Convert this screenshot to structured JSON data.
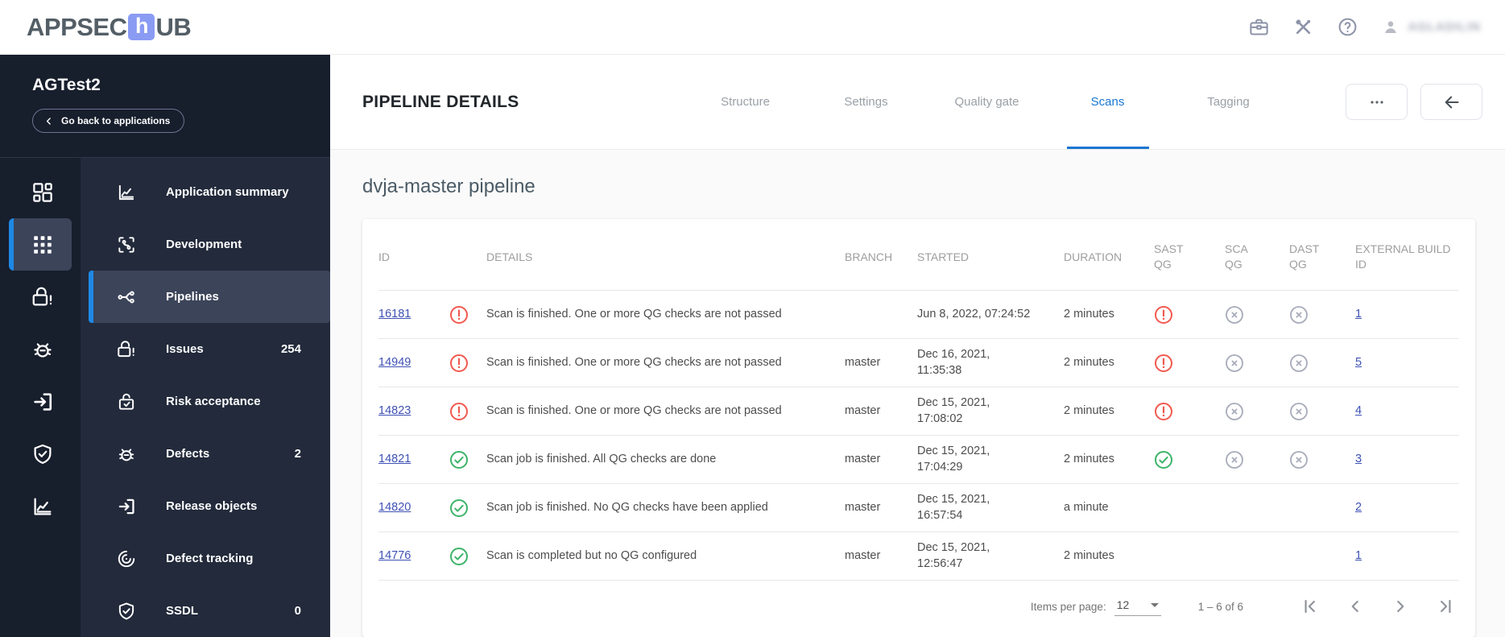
{
  "topbar": {
    "logo": {
      "prefix": "APPSEC",
      "h_letter": "h",
      "suffix": "UB"
    },
    "icons": [
      "briefcase",
      "tools",
      "help"
    ],
    "user": {
      "name": "AGLADILIN"
    }
  },
  "sidebar": {
    "project_name": "AGTest2",
    "back_button_label": "Go back to applications",
    "rail_icons": [
      {
        "icon": "dashboard",
        "active": false
      },
      {
        "icon": "apps",
        "active": true
      },
      {
        "icon": "lock-alert",
        "active": false
      },
      {
        "icon": "bug",
        "active": false
      },
      {
        "icon": "exit-to-app",
        "active": false
      },
      {
        "icon": "shield-check",
        "active": false
      },
      {
        "icon": "line-chart",
        "active": false
      }
    ],
    "items": [
      {
        "label": "Application summary",
        "icon": "line-chart",
        "count": "",
        "active": false
      },
      {
        "label": "Development",
        "icon": "development",
        "count": "",
        "active": false
      },
      {
        "label": "Pipelines",
        "icon": "pipelines",
        "count": "",
        "active": true
      },
      {
        "label": "Issues",
        "icon": "lock-alert",
        "count": "254",
        "active": false
      },
      {
        "label": "Risk acceptance",
        "icon": "lock-check",
        "count": "",
        "active": false
      },
      {
        "label": "Defects",
        "icon": "bug",
        "count": "2",
        "active": false
      },
      {
        "label": "Release objects",
        "icon": "exit-to-app",
        "count": "",
        "active": false
      },
      {
        "label": "Defect tracking",
        "icon": "track-changes",
        "count": "",
        "active": false
      },
      {
        "label": "SSDL",
        "icon": "shield-check",
        "count": "0",
        "active": false
      }
    ]
  },
  "header": {
    "title": "PIPELINE DETAILS",
    "tabs": [
      {
        "label": "Structure",
        "active": false
      },
      {
        "label": "Settings",
        "active": false
      },
      {
        "label": "Quality gate",
        "active": false
      },
      {
        "label": "Scans",
        "active": true
      },
      {
        "label": "Tagging",
        "active": false
      }
    ],
    "actions": [
      {
        "icon": "more-horizontal"
      },
      {
        "icon": "arrow-left"
      }
    ]
  },
  "main": {
    "pipeline_title": "dvja-master pipeline",
    "table": {
      "columns": [
        "ID",
        "DETAILS",
        "BRANCH",
        "STARTED",
        "DURATION",
        "SAST QG",
        "SCA QG",
        "DAST QG",
        "EXTERNAL BUILD ID"
      ],
      "rows": [
        {
          "id": "16181",
          "status": "error",
          "details": "Scan is finished. One or more QG checks are not passed",
          "branch": "",
          "started": "Jun 8, 2022, 07:24:52",
          "duration": "2 minutes",
          "sast_qg": "error",
          "sca_qg": "cancelled",
          "dast_qg": "cancelled",
          "external_build_id": "1"
        },
        {
          "id": "14949",
          "status": "error",
          "details": "Scan is finished. One or more QG checks are not passed",
          "branch": "master",
          "started": "Dec 16, 2021, 11:35:38",
          "duration": "2 minutes",
          "sast_qg": "error",
          "sca_qg": "cancelled",
          "dast_qg": "cancelled",
          "external_build_id": "5"
        },
        {
          "id": "14823",
          "status": "error",
          "details": "Scan is finished. One or more QG checks are not passed",
          "branch": "master",
          "started": "Dec 15, 2021, 17:08:02",
          "duration": "2 minutes",
          "sast_qg": "error",
          "sca_qg": "cancelled",
          "dast_qg": "cancelled",
          "external_build_id": "4"
        },
        {
          "id": "14821",
          "status": "success",
          "details": "Scan job is finished. All QG checks are done",
          "branch": "master",
          "started": "Dec 15, 2021, 17:04:29",
          "duration": "2 minutes",
          "sast_qg": "success",
          "sca_qg": "cancelled",
          "dast_qg": "cancelled",
          "external_build_id": "3"
        },
        {
          "id": "14820",
          "status": "success",
          "details": "Scan job is finished. No QG checks have been applied",
          "branch": "master",
          "started": "Dec 15, 2021, 16:57:54",
          "duration": "a minute",
          "sast_qg": "none",
          "sca_qg": "none",
          "dast_qg": "none",
          "external_build_id": "2"
        },
        {
          "id": "14776",
          "status": "success",
          "details": "Scan is completed but no QG configured",
          "branch": "master",
          "started": "Dec 15, 2021, 12:56:47",
          "duration": "2 minutes",
          "sast_qg": "none",
          "sca_qg": "none",
          "dast_qg": "none",
          "external_build_id": "1"
        }
      ]
    },
    "pagination": {
      "items_per_page_label": "Items per page:",
      "items_per_page_value": "12",
      "range_label": "1 – 6 of 6",
      "nav_icons": [
        "first-page",
        "prev-page",
        "next-page",
        "last-page"
      ]
    }
  },
  "colors": {
    "accent_blue": "#1e88e5",
    "active_tab_blue": "#1976d2",
    "link_indigo": "#3f51b5",
    "status_error": "#f2594f",
    "status_success": "#3cb469",
    "status_cancelled": "#a7abb9",
    "sidebar_dark": "#171e2c",
    "sidebar_menu": "#222a3b",
    "logo_block": "#8a9bf3"
  }
}
